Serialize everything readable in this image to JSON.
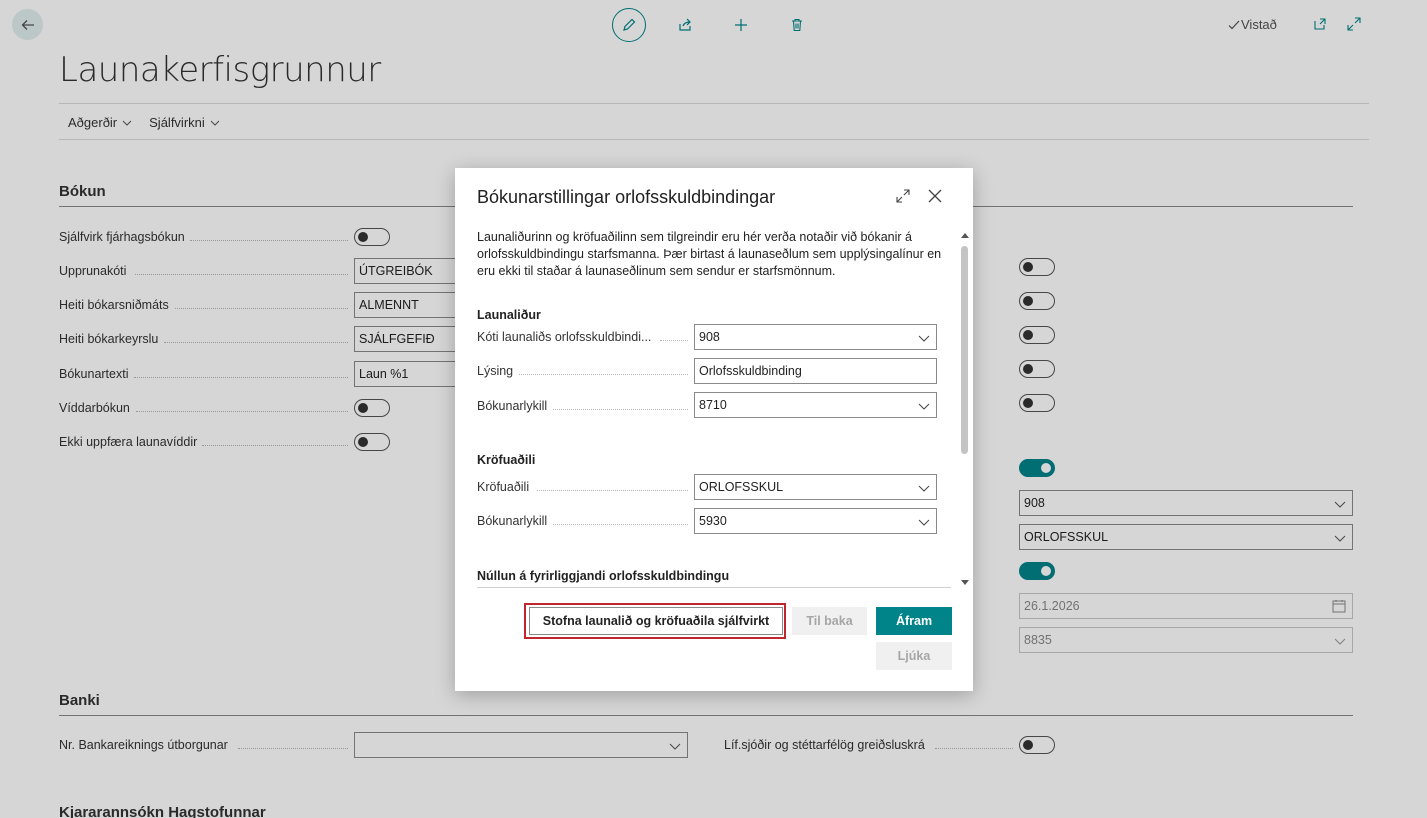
{
  "header": {
    "status": "Vistað",
    "page_title": "Launakerfisgrunnur"
  },
  "actionbar": {
    "actions_label": "Aðgerðir",
    "automate_label": "Sjálfvirkni"
  },
  "sections": {
    "bokun": "Bókun",
    "banki": "Banki",
    "hagstofa": "Kjararannsókn Hagstofunnar"
  },
  "left_fields": [
    {
      "label": "Sjálfvirk fjárhagsbókun",
      "kind": "toggle",
      "on": false
    },
    {
      "label": "Upprunakóti",
      "kind": "input",
      "value": "ÚTGREIBÓK"
    },
    {
      "label": "Heiti bókarsniðmáts",
      "kind": "input",
      "value": "ALMENNT"
    },
    {
      "label": "Heiti bókarkeyrslu",
      "kind": "input",
      "value": "SJÁLFGEFIÐ"
    },
    {
      "label": "Bókunartexti",
      "kind": "input",
      "value": "Laun %1"
    },
    {
      "label": "Víddarbókun",
      "kind": "toggle",
      "on": false
    },
    {
      "label": "Ekki uppfæra launavíddir",
      "kind": "toggle",
      "on": false
    }
  ],
  "right_fields": {
    "dropdown1": "908",
    "dropdown2": "ORLOFSSKUL",
    "date": "26.1.2026",
    "dropdown3": "8835"
  },
  "bank": {
    "account_label": "Nr. Bankareiknings útborgunar",
    "account_value": "",
    "pension_label": "Líf.sjóðir og stéttarfélög greiðsluskrá"
  },
  "dialog": {
    "title": "Bókunarstillingar orlofsskuldbindingar",
    "description": "Launaliðurinn og kröfuaðilinn sem tilgreindir eru hér verða notaðir við bókanir á orlofsskuldbindingu starfsmanna. Þær birtast á launaseðlum sem upplýsingalínur en eru ekki til staðar á launaseðlinum sem sendur er starfsmönnum.",
    "group1": "Launaliður",
    "wage_code_label": "Kóti launaliðs orlofsskuldbindi...",
    "wage_code_value": "908",
    "description_label": "Lýsing",
    "description_value": "Orlofsskuldbinding",
    "account1_label": "Bókunarlykill",
    "account1_value": "8710",
    "group2": "Kröfuaðili",
    "creditor_label": "Kröfuaðili",
    "creditor_value": "ORLOFSSKUL",
    "account2_label": "Bókunarlykill",
    "account2_value": "5930",
    "group3": "Núllun á fyrirliggjandi orlofsskuldbindingu",
    "btn_create": "Stofna launalið og kröfuaðila sjálfvirkt",
    "btn_back": "Til baka",
    "btn_next": "Áfram",
    "btn_finish": "Ljúka"
  },
  "colors": {
    "accent": "#008489",
    "highlight": "#c0262d"
  }
}
